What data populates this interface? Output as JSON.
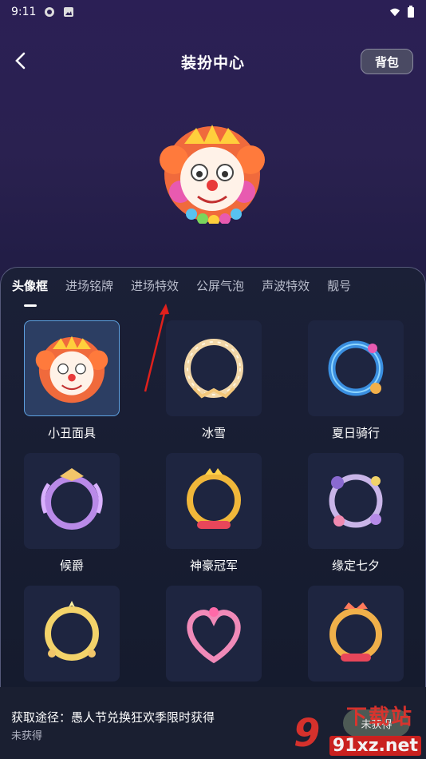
{
  "status_bar": {
    "time": "9:11"
  },
  "header": {
    "title": "装扮中心",
    "bag_label": "背包"
  },
  "tabs": [
    {
      "label": "头像框",
      "active": true
    },
    {
      "label": "进场铭牌",
      "active": false
    },
    {
      "label": "进场特效",
      "active": false
    },
    {
      "label": "公屏气泡",
      "active": false
    },
    {
      "label": "声波特效",
      "active": false
    },
    {
      "label": "靓号",
      "active": false
    }
  ],
  "frames": [
    {
      "name": "小丑面具",
      "selected": true
    },
    {
      "name": "冰雪",
      "selected": false
    },
    {
      "name": "夏日骑行",
      "selected": false
    },
    {
      "name": "候爵",
      "selected": false
    },
    {
      "name": "神豪冠军",
      "selected": false
    },
    {
      "name": "缘定七夕",
      "selected": false
    },
    {
      "name": "",
      "selected": false
    },
    {
      "name": "",
      "selected": false
    },
    {
      "name": "",
      "selected": false
    }
  ],
  "footer": {
    "source": "获取途径：愚人节兑换狂欢季限时获得",
    "status": "未获得",
    "action_label": "未获得"
  },
  "watermark": {
    "top": "下载站",
    "bottom": "91xz.net"
  },
  "colors": {
    "accent_selected": "#5ea1e0",
    "panel": "#1b2037",
    "watermark_red": "#e0322c"
  }
}
